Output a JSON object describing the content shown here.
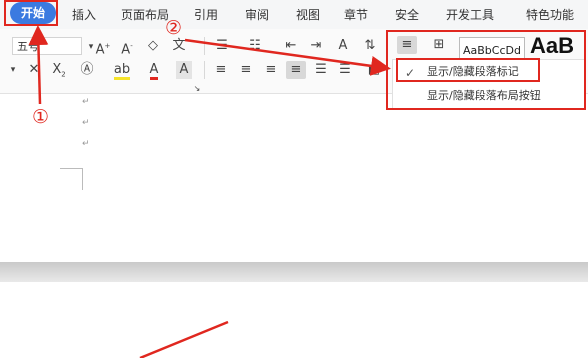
{
  "tabs": [
    "开始",
    "插入",
    "页面布局",
    "引用",
    "审阅",
    "视图",
    "章节",
    "安全",
    "开发工具",
    "特色功能"
  ],
  "ribbon": {
    "font_size_value": "五号",
    "style_preview": "AaBbCcDd",
    "style_preview_big": "AaB"
  },
  "dropdown": {
    "items": [
      "显示/隐藏段落标记",
      "显示/隐藏段落布局按钮"
    ],
    "checked_index": 0
  },
  "annotations": {
    "step1": "①",
    "step2": "②"
  },
  "document": {
    "paragraph_mark": "↵"
  },
  "colors": {
    "accent": "#3b7ae0",
    "annotation": "#e0271f"
  }
}
